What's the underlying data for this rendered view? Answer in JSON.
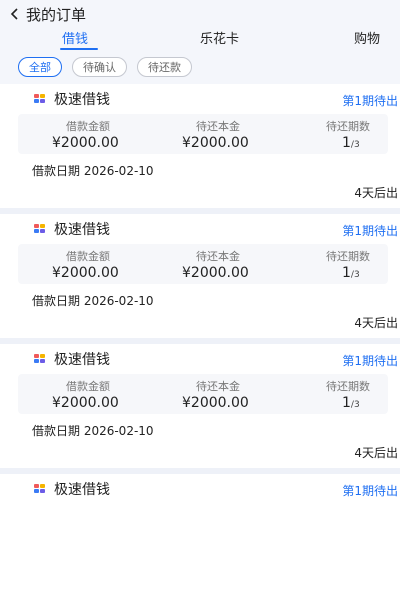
{
  "header": {
    "title": "我的订单",
    "back_icon": "chevron-left-icon"
  },
  "tabs": [
    {
      "label": "借钱",
      "active": true
    },
    {
      "label": "乐花卡",
      "active": false
    },
    {
      "label": "购物",
      "active": false
    }
  ],
  "filters": [
    {
      "label": "全部",
      "selected": true
    },
    {
      "label": "待确认",
      "selected": false
    },
    {
      "label": "待还款",
      "selected": false
    }
  ],
  "orders": [
    {
      "brand": "极速借钱",
      "status": "第1期待出",
      "loan_label": "借款金额",
      "loan_value": "¥2000.00",
      "principal_label": "待还本金",
      "principal_value": "¥2000.00",
      "periods_label": "待还期数",
      "periods_current": "1",
      "periods_total": "/3",
      "date_text": "借款日期 2026-02-10",
      "due_text": "4天后出"
    },
    {
      "brand": "极速借钱",
      "status": "第1期待出",
      "loan_label": "借款金额",
      "loan_value": "¥2000.00",
      "principal_label": "待还本金",
      "principal_value": "¥2000.00",
      "periods_label": "待还期数",
      "periods_current": "1",
      "periods_total": "/3",
      "date_text": "借款日期 2026-02-10",
      "due_text": "4天后出"
    },
    {
      "brand": "极速借钱",
      "status": "第1期待出",
      "loan_label": "借款金额",
      "loan_value": "¥2000.00",
      "principal_label": "待还本金",
      "principal_value": "¥2000.00",
      "periods_label": "待还期数",
      "periods_current": "1",
      "periods_total": "/3",
      "date_text": "借款日期 2026-02-10",
      "due_text": "4天后出"
    },
    {
      "brand": "极速借钱",
      "status": "第1期待出"
    }
  ],
  "colors": {
    "accent": "#1f6ff2"
  }
}
